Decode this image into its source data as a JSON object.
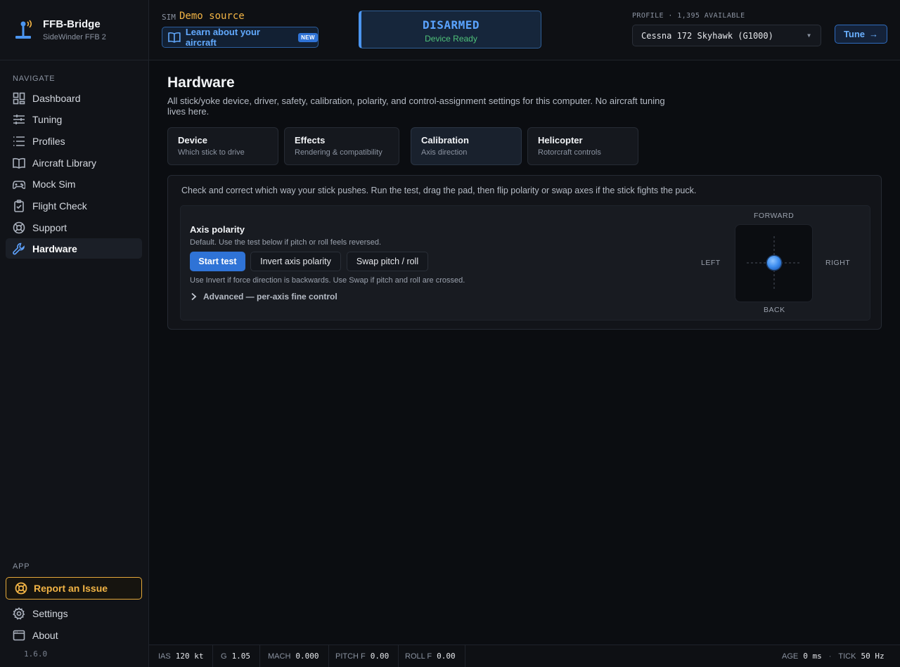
{
  "brand": {
    "title": "FFB-Bridge",
    "subtitle": "SideWinder FFB 2"
  },
  "sidebar": {
    "navigate_label": "NAVIGATE",
    "items": [
      {
        "label": "Dashboard",
        "icon": "grid-icon"
      },
      {
        "label": "Tuning",
        "icon": "sliders-icon"
      },
      {
        "label": "Profiles",
        "icon": "list-icon"
      },
      {
        "label": "Aircraft Library",
        "icon": "book-icon"
      },
      {
        "label": "Mock Sim",
        "icon": "gamepad-icon"
      },
      {
        "label": "Flight Check",
        "icon": "clipboard-icon"
      },
      {
        "label": "Support",
        "icon": "lifebuoy-icon"
      },
      {
        "label": "Hardware",
        "icon": "wrench-icon",
        "active": true
      }
    ],
    "app_label": "APP",
    "report_label": "Report an Issue",
    "settings_label": "Settings",
    "about_label": "About",
    "version": "1.6.0"
  },
  "header": {
    "sim_label": "SIM",
    "sim_value": "Demo source",
    "learn_label": "Learn about your aircraft",
    "new_badge": "NEW",
    "status_main": "DISARMED",
    "status_sub": "Device Ready",
    "profile_label": "PROFILE · 1,395 AVAILABLE",
    "profile_value": "Cessna 172 Skyhawk (G1000)",
    "tune_label": "Tune"
  },
  "page": {
    "title": "Hardware",
    "description": "All stick/yoke device, driver, safety, calibration, polarity, and control-assignment settings for this computer. No aircraft tuning lives here.",
    "tabs": [
      {
        "title": "Device",
        "subtitle": "Which stick to drive"
      },
      {
        "title": "Effects",
        "subtitle": "Rendering & compatibility"
      },
      {
        "title": "Calibration",
        "subtitle": "Axis direction",
        "active": true
      },
      {
        "title": "Helicopter",
        "subtitle": "Rotorcraft controls"
      }
    ]
  },
  "calibration": {
    "description": "Check and correct which way your stick pushes. Run the test, drag the pad, then flip polarity or swap axes if the stick fights the puck.",
    "axis_title": "Axis polarity",
    "axis_desc": "Default. Use the test below if pitch or roll feels reversed.",
    "start_label": "Start test",
    "invert_label": "Invert axis polarity",
    "swap_label": "Swap pitch / roll",
    "hint": "Use Invert if force direction is backwards. Use Swap if pitch and roll are crossed.",
    "advanced_label": "Advanced — per-axis fine control",
    "forward": "FORWARD",
    "back": "BACK",
    "left": "LEFT",
    "right": "RIGHT"
  },
  "footer": {
    "ias_label": "IAS",
    "ias_value": "120 kt",
    "g_label": "G",
    "g_value": "1.05",
    "mach_label": "MACH",
    "mach_value": "0.000",
    "pitch_label": "PITCH F",
    "pitch_value": "0.00",
    "roll_label": "ROLL F",
    "roll_value": "0.00",
    "age_label": "AGE",
    "age_value": "0 ms",
    "tick_label": "TICK",
    "tick_value": "50 Hz"
  },
  "colors": {
    "accent": "#2f73d6",
    "warning": "#f2b445",
    "ok": "#4fc27a"
  }
}
